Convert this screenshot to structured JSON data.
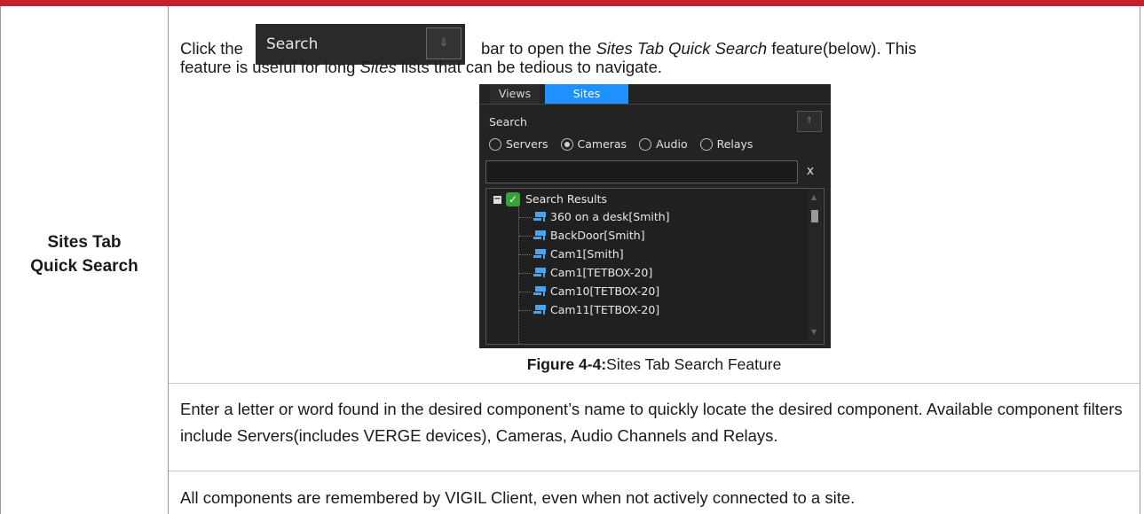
{
  "row_label": [
    "Sites Tab",
    "Quick Search"
  ],
  "intro": {
    "before": "Click the",
    "after": "bar to open the",
    "feature_name": "Sites Tab Quick Search",
    "after2": "feature(below). This",
    "line2_before": "feature is useful for long",
    "line2_sites": "Sites",
    "line2_after": "lists that can be tedious to navigate."
  },
  "inline_search": {
    "label": "Search",
    "button_icon": "double-chevron-down-icon"
  },
  "screenshot": {
    "tabs": [
      "Views",
      "Sites"
    ],
    "active_tab": "Sites",
    "search_label": "Search",
    "collapse_icon": "double-chevron-up-icon",
    "filters": [
      {
        "label": "Servers",
        "selected": false
      },
      {
        "label": "Cameras",
        "selected": true
      },
      {
        "label": "Audio",
        "selected": false
      },
      {
        "label": "Relays",
        "selected": false
      }
    ],
    "input_value": "",
    "clear_label": "x",
    "tree_root": "Search Results",
    "results": [
      "360 on a desk[Smith]",
      "BackDoor[Smith]",
      "Cam1[Smith]",
      "Cam1[TETBOX-20]",
      "Cam10[TETBOX-20]",
      "Cam11[TETBOX-20]"
    ],
    "colors": {
      "panel": "#232323",
      "active_tab": "#1e90ff",
      "camera_icon": "#4aa3f0",
      "check": "#3aa13a"
    }
  },
  "caption": {
    "label": "Figure 4-4:",
    "text": "Sites Tab Search Feature"
  },
  "para2": "Enter a letter or word found in the desired component’s name to quickly locate the desired component. Available component filters include Servers(includes VERGE devices), Cameras, Audio Channels and Relays.",
  "para3": "All components are remembered by VIGIL Client, even when not actively connected to a site.",
  "colors": {
    "top_bar": "#c8202a",
    "border": "#9a9a9a"
  }
}
